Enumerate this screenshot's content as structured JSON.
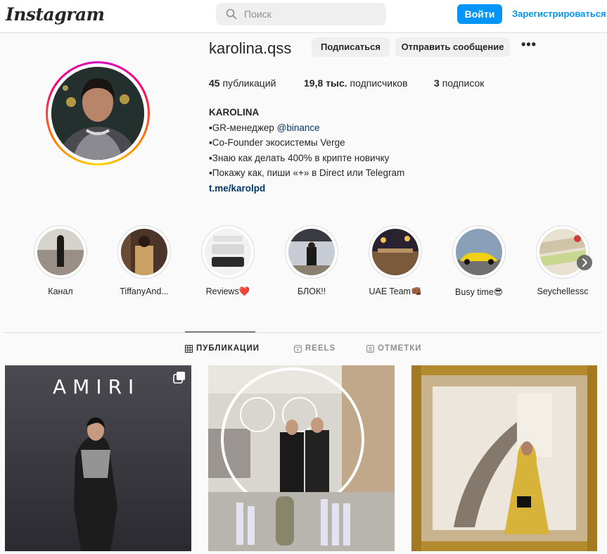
{
  "header": {
    "logo": "Instagram",
    "search_placeholder": "Поиск",
    "login_label": "Войти",
    "signup_label": "Зарегистрироваться"
  },
  "profile": {
    "username": "karolina.qss",
    "follow_label": "Подписаться",
    "message_label": "Отправить сообщение",
    "more_label": "•••",
    "stats": {
      "posts_count": "45",
      "posts_label": "публикаций",
      "followers_count": "19,8 тыс.",
      "followers_label": "подписчиков",
      "following_count": "3",
      "following_label": "подписок"
    },
    "bio": {
      "name": "KAROLINA",
      "line1_prefix": "▪GR-менеджер ",
      "line1_mention": "@binance",
      "line2": "▪Co-Founder экосистемы Verge",
      "line3": "▪Знаю как делать 400% в крипте новичку",
      "line4": "▪Покажу как, пиши «+» в Direct или Telegram",
      "link": "t.me/karolpd"
    }
  },
  "highlights": [
    {
      "label": "Канал"
    },
    {
      "label": "TiffanyAnd..."
    },
    {
      "label": "Reviews❤️"
    },
    {
      "label": "БЛОК!!"
    },
    {
      "label": "UAE Team👊🏾"
    },
    {
      "label": "Busy time😎"
    },
    {
      "label": "Seychellessc"
    }
  ],
  "tabs": {
    "posts": "ПУБЛИКАЦИИ",
    "reels": "REELS",
    "tagged": "ОТМЕТКИ"
  },
  "posts": [
    {
      "overlay_text": "AMIRI",
      "multi": true
    },
    {
      "overlay_text": "",
      "multi": false
    },
    {
      "overlay_text": "",
      "multi": false
    }
  ],
  "colors": {
    "accent": "#0095f6",
    "link": "#00376b",
    "text": "#262626",
    "muted": "#8e8e8e"
  }
}
